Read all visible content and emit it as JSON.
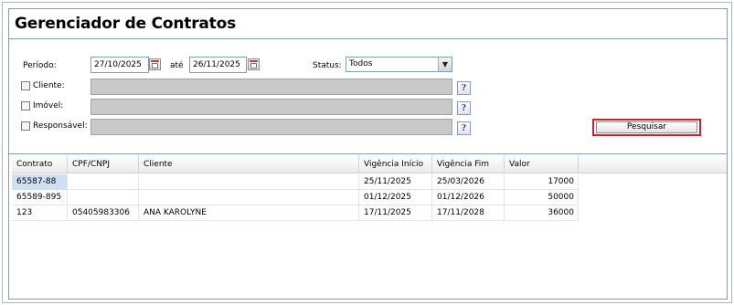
{
  "page": {
    "title": "Gerenciador de Contratos"
  },
  "filters": {
    "periodo_label": "Período:",
    "date_from": "27/10/2025",
    "ate_label": "até",
    "date_to": "26/11/2025",
    "status_label": "Status:",
    "status_value": "Todos",
    "cliente_label": "Cliente:",
    "imovel_label": "Imóvel:",
    "responsavel_label": "Responsável:",
    "help_glyph": "?",
    "search_label": "Pesquisar",
    "calendar_icon": "calendar-icon",
    "dropdown_icon": "chevron-down-icon"
  },
  "grid": {
    "columns": [
      "Contrato",
      "CPF/CNPJ",
      "Cliente",
      "Vigência Início",
      "Vigência Fim",
      "Valor"
    ],
    "rows": [
      {
        "contrato": "65587-88",
        "cpf": "",
        "cliente": "",
        "inicio": "25/11/2025",
        "fim": "25/03/2026",
        "valor": "17000"
      },
      {
        "contrato": "65589-895",
        "cpf": "",
        "cliente": "",
        "inicio": "01/12/2025",
        "fim": "01/12/2026",
        "valor": "50000"
      },
      {
        "contrato": "123",
        "cpf": "05405983306",
        "cliente": "ANA KAROLYNE",
        "inicio": "17/11/2025",
        "fim": "17/11/2028",
        "valor": "36000"
      }
    ]
  },
  "colors": {
    "frame_border": "#7f9db9",
    "selection": "#cfe0f5",
    "highlight": "#d0202a",
    "field_gray": "#c9c9c9"
  }
}
